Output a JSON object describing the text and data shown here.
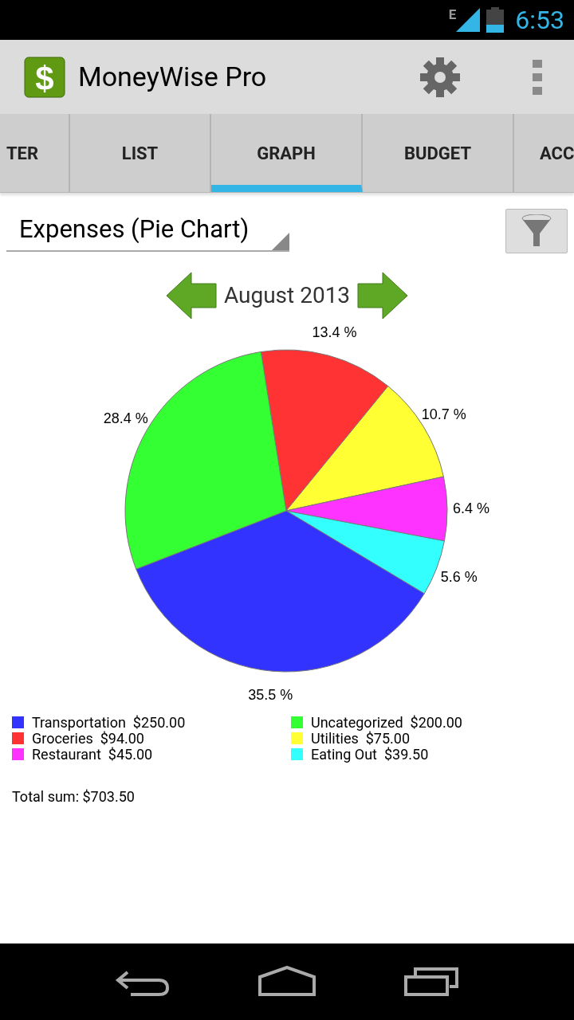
{
  "status_bar": {
    "network": "E",
    "time": "6:53"
  },
  "action_bar": {
    "logo": "$",
    "title": "MoneyWise Pro"
  },
  "tabs": [
    {
      "label": "TER",
      "selected": false
    },
    {
      "label": "LIST",
      "selected": false
    },
    {
      "label": "GRAPH",
      "selected": true
    },
    {
      "label": "BUDGET",
      "selected": false
    },
    {
      "label": "ACC",
      "selected": false
    }
  ],
  "report_dropdown": {
    "value": "Expenses (Pie Chart)"
  },
  "period": "August 2013",
  "chart_data": {
    "type": "pie",
    "values": [
      13.4,
      10.7,
      6.4,
      5.6,
      35.5,
      28.4
    ],
    "colors": [
      "#ff3333",
      "#ffff33",
      "#ff33ff",
      "#33ffff",
      "#3333ff",
      "#33ff33"
    ],
    "value_labels": [
      "13.4 %",
      "10.7 %",
      "6.4 %",
      "5.6 %",
      "35.5 %",
      "28.4 %"
    ]
  },
  "legend": [
    {
      "label": "Transportation  $250.00",
      "color": "#3333ff"
    },
    {
      "label": "Uncategorized  $200.00",
      "color": "#33ff33"
    },
    {
      "label": "Groceries  $94.00",
      "color": "#ff3333"
    },
    {
      "label": "Utilities  $75.00",
      "color": "#ffff33"
    },
    {
      "label": "Restaurant  $45.00",
      "color": "#ff33ff"
    },
    {
      "label": "Eating Out  $39.50",
      "color": "#33ffff"
    }
  ],
  "total": "Total sum: $703.50"
}
